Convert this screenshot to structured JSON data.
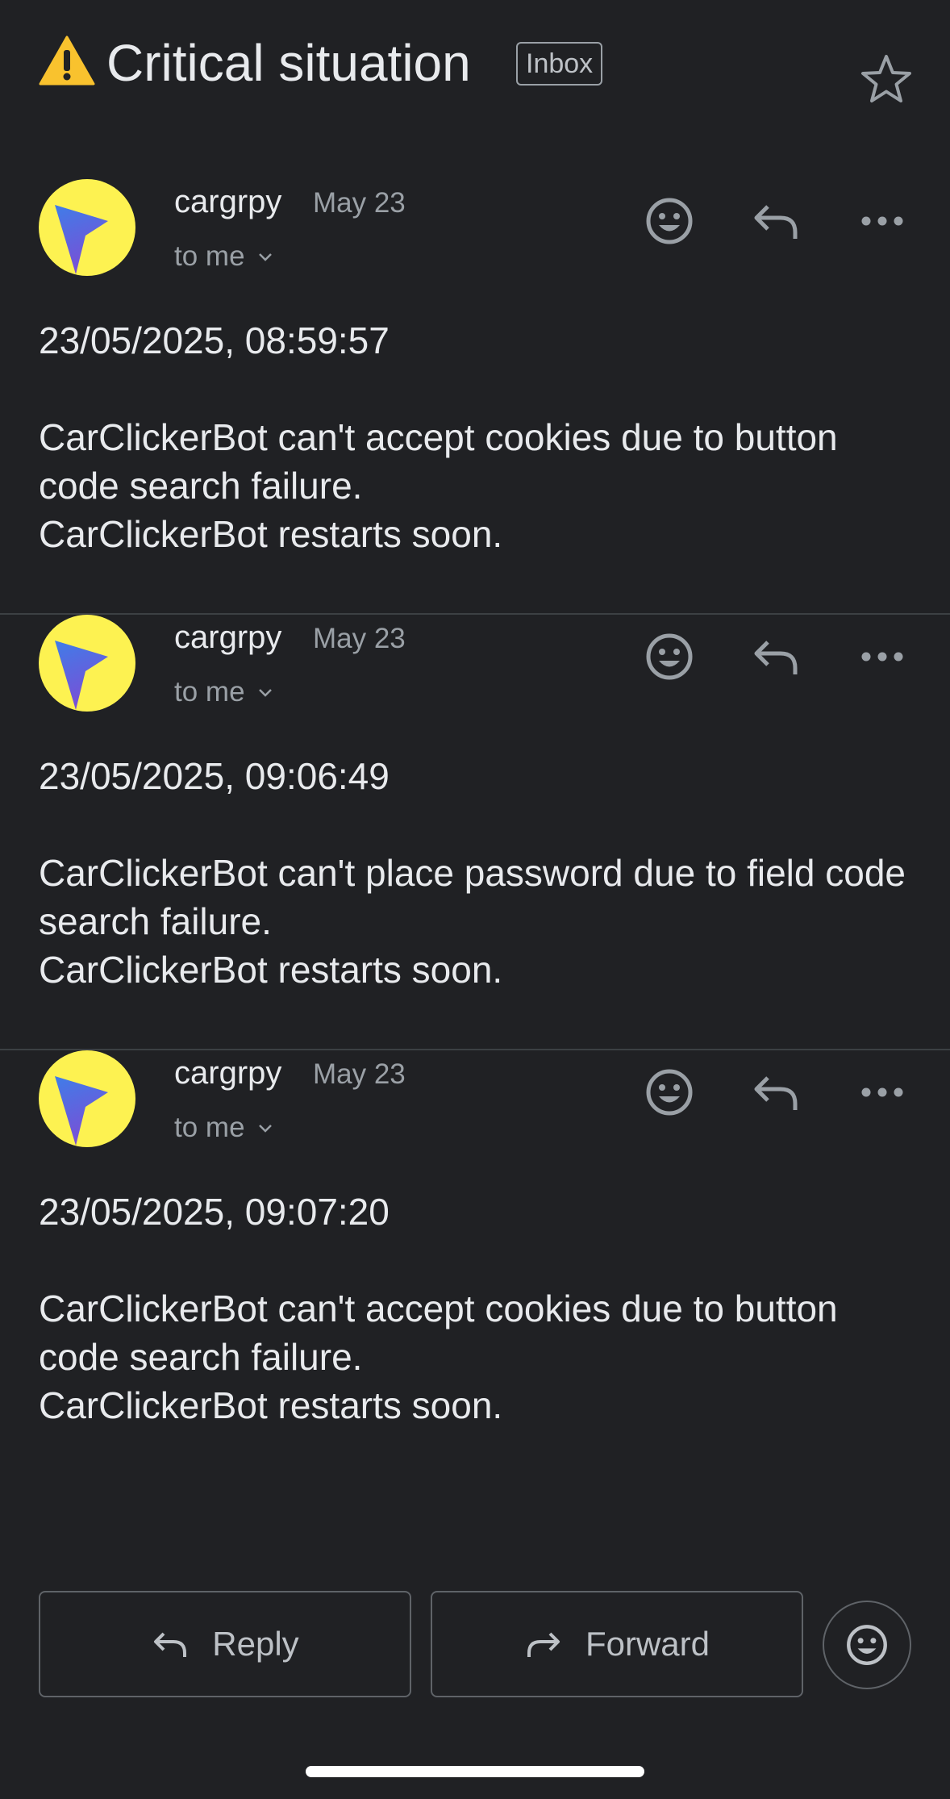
{
  "thread": {
    "subject": "Critical situation",
    "label": "Inbox"
  },
  "messages": [
    {
      "sender": "cargrpy",
      "date": "May 23",
      "recipient": "to me",
      "body": "23/05/2025, 08:59:57\n\nCarClickerBot can't accept cookies due to button code search failure.\nCarClickerBot restarts soon."
    },
    {
      "sender": "cargrpy",
      "date": "May 23",
      "recipient": "to me",
      "body": "23/05/2025, 09:06:49\n\nCarClickerBot can't place password due to field code search failure.\nCarClickerBot restarts soon."
    },
    {
      "sender": "cargrpy",
      "date": "May 23",
      "recipient": "to me",
      "body": "23/05/2025, 09:07:20\n\nCarClickerBot can't accept cookies due to button code search failure.\nCarClickerBot restarts soon."
    }
  ],
  "actions": {
    "reply_label": "Reply",
    "forward_label": "Forward"
  },
  "icons": {
    "subject": "warning-icon",
    "star": "star-outline-icon",
    "message_actions": [
      "emoji-reaction-icon",
      "reply-icon",
      "more-horizontal-icon"
    ],
    "avatar": "navigation-arrow-icon"
  },
  "colors": {
    "background": "#202124",
    "divider": "#3c4043",
    "avatar_bg": "#fdf251",
    "avatar_arrow_top": "#3f7de8",
    "avatar_arrow_bottom": "#7a4fd6",
    "warning": "#f9c22e"
  }
}
